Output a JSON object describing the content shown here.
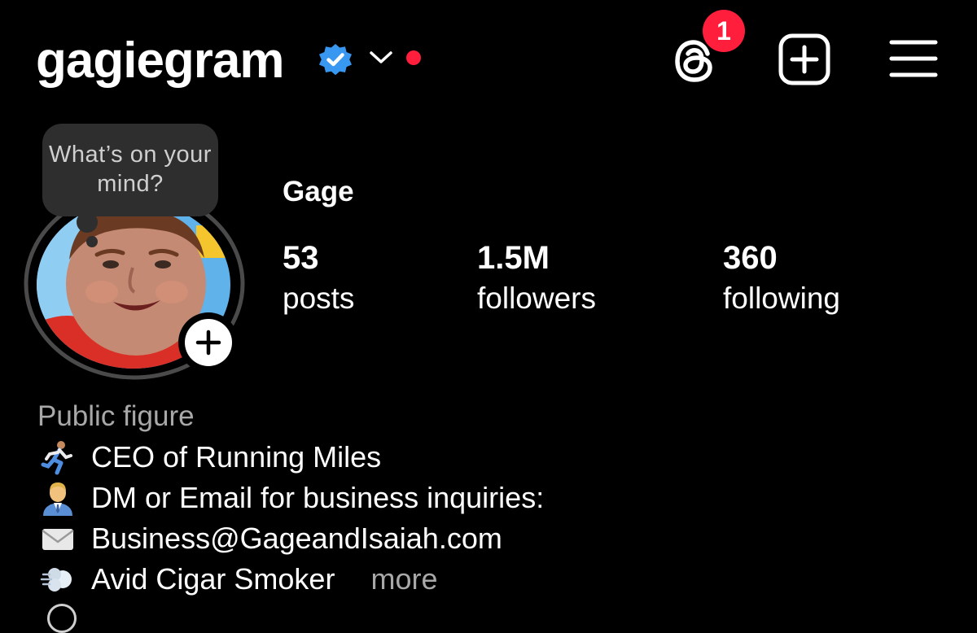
{
  "header": {
    "username": "gagiegram",
    "verified_icon": "verified-badge-icon",
    "chevron_icon": "chevron-down-icon",
    "threads_icon": "threads-icon",
    "threads_badge": "1",
    "create_icon": "plus-square-icon",
    "menu_icon": "hamburger-menu-icon"
  },
  "note": {
    "text": "What’s on your mind?"
  },
  "profile": {
    "display_name": "Gage",
    "stats": {
      "posts": {
        "value": "53",
        "label": "posts"
      },
      "followers": {
        "value": "1.5M",
        "label": "followers"
      },
      "following": {
        "value": "360",
        "label": "following"
      }
    }
  },
  "bio": {
    "category": "Public figure",
    "lines": [
      {
        "icon": "runner-emoji-icon",
        "text": "CEO of Running Miles"
      },
      {
        "icon": "office-worker-emoji-icon",
        "text": "DM or Email for business inquiries:"
      },
      {
        "icon": "envelope-emoji-icon",
        "text": "Business@GageandIsaiah.com"
      },
      {
        "icon": "dash-emoji-icon",
        "text": "Avid Cigar Smoker"
      }
    ],
    "more": "more"
  },
  "colors": {
    "background": "#000000",
    "verified_blue": "#3897f0",
    "notification_red": "#ff1e3c",
    "secondary_text": "#a8a8a8",
    "note_bubble": "#2e2e2e"
  }
}
